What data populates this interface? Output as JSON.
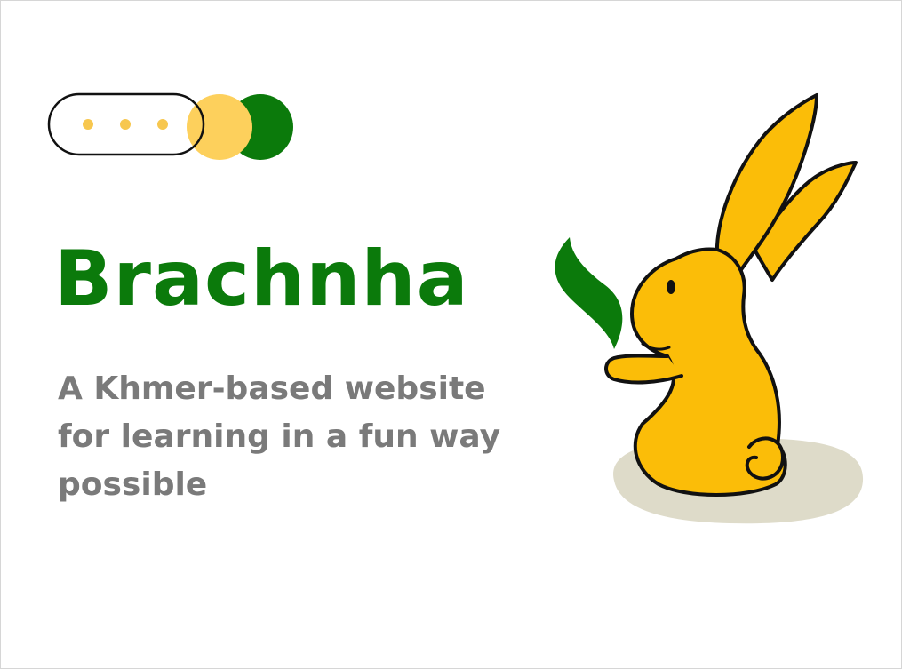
{
  "brand": {
    "title": "Brachnha",
    "tagline": "A Khmer-based website for learning in a fun way possible"
  },
  "logo": {
    "icon": "chat-bubble-dots-icon",
    "dots_color": "#f7c74f",
    "circle_colors": [
      "#fdd05c",
      "#0b7a0b"
    ]
  },
  "mascot": {
    "icon": "rabbit-with-leaf-icon",
    "body_color": "#fbbd08",
    "leaf_color": "#0b7a0b",
    "shadow_color": "#dedbc9"
  },
  "colors": {
    "brand_green": "#0b7a0b",
    "tagline_gray": "#7a7a7a"
  }
}
